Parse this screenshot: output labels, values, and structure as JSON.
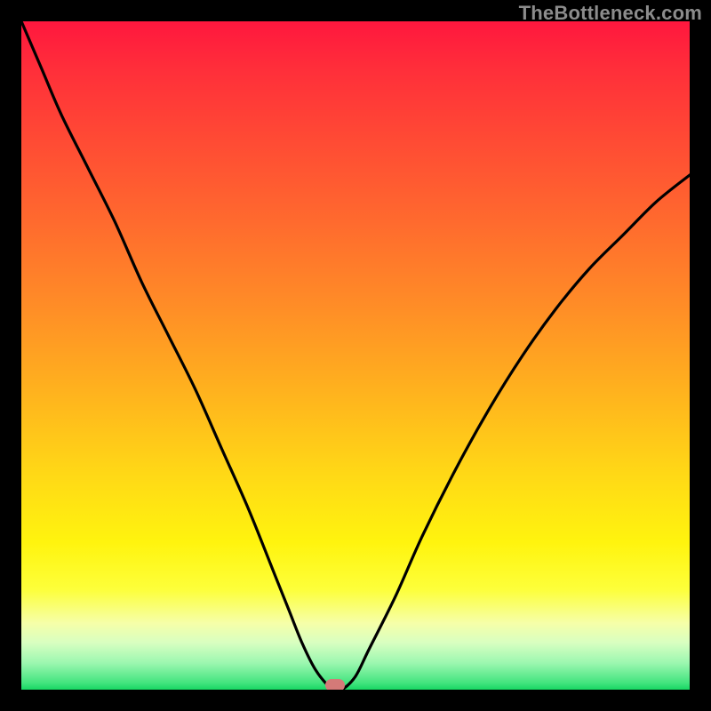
{
  "watermark": {
    "text": "TheBottleneck.com"
  },
  "colors": {
    "frame": "#000000",
    "curve": "#000000",
    "marker": "#d47a78"
  },
  "chart_data": {
    "type": "line",
    "title": "",
    "xlabel": "",
    "ylabel": "",
    "xlim": [
      0,
      100
    ],
    "ylim": [
      0,
      100
    ],
    "grid": false,
    "legend": false,
    "series": [
      {
        "name": "bottleneck-curve",
        "x": [
          0,
          3,
          6,
          10,
          14,
          18,
          22,
          26,
          30,
          34,
          38,
          40,
          42,
          44,
          46,
          47,
          48,
          50,
          52,
          56,
          60,
          65,
          70,
          75,
          80,
          85,
          90,
          95,
          100
        ],
        "values": [
          100,
          93,
          86,
          78,
          70,
          61,
          53,
          45,
          36,
          27,
          17,
          12,
          7,
          3,
          0.5,
          0,
          0,
          2,
          6,
          14,
          23,
          33,
          42,
          50,
          57,
          63,
          68,
          73,
          77
        ]
      }
    ],
    "annotations": [
      {
        "name": "min-marker",
        "x": 47,
        "y": 0.6
      }
    ]
  }
}
